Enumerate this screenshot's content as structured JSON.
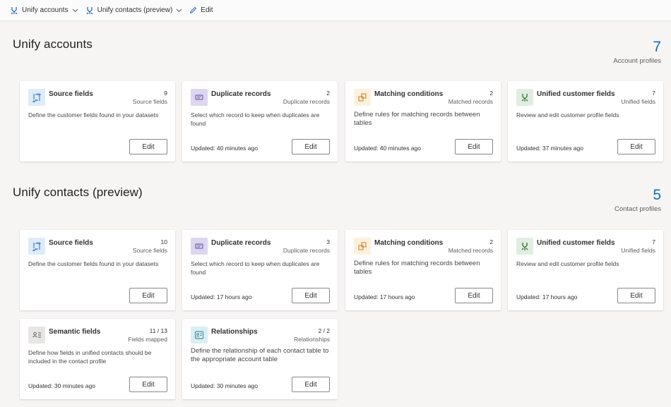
{
  "commandbar": {
    "items": [
      {
        "label": "Unify accounts",
        "has_dropdown": true,
        "icon": "unify-icon"
      },
      {
        "label": "Unify contacts (preview)",
        "has_dropdown": true,
        "icon": "unify-icon"
      },
      {
        "label": "Edit",
        "has_dropdown": false,
        "icon": "pencil-icon"
      }
    ]
  },
  "accounts": {
    "title": "Unify accounts",
    "metric_value": "7",
    "metric_label": "Account profiles",
    "cards": [
      {
        "title": "Source fields",
        "count": "9",
        "unit": "Source fields",
        "desc": "Define the customer fields found in your datasets",
        "updated": "",
        "button": "Edit",
        "icon": "source-fields-icon"
      },
      {
        "title": "Duplicate records",
        "count": "2",
        "unit": "Duplicate records",
        "desc": "Select which record to keep when duplicates are found",
        "updated": "Updated: 40 minutes ago",
        "button": "Edit",
        "icon": "duplicate-records-icon"
      },
      {
        "title": "Matching conditions",
        "count": "2",
        "unit": "Matched records",
        "desc": "Define rules for matching records between tables",
        "updated": "Updated: 40 minutes ago",
        "button": "Edit",
        "icon": "matching-conditions-icon"
      },
      {
        "title": "Unified customer fields",
        "count": "7",
        "unit": "Unified fields",
        "desc": "Review and edit customer profile fields",
        "updated": "Updated: 37 minutes ago",
        "button": "Edit",
        "icon": "unified-fields-icon"
      }
    ]
  },
  "contacts": {
    "title": "Unify contacts (preview)",
    "metric_value": "5",
    "metric_label": "Contact profiles",
    "cards": [
      {
        "title": "Source fields",
        "count": "10",
        "unit": "Source fields",
        "desc": "Define the customer fields found in your datasets",
        "updated": "",
        "button": "Edit",
        "icon": "source-fields-icon"
      },
      {
        "title": "Duplicate records",
        "count": "3",
        "unit": "Duplicate records",
        "desc": "Select which record to keep when duplicates are found",
        "updated": "Updated: 17 hours ago",
        "button": "Edit",
        "icon": "duplicate-records-icon"
      },
      {
        "title": "Matching conditions",
        "count": "2",
        "unit": "Matched records",
        "desc": "Define rules for matching records between tables",
        "updated": "Updated: 17 hours ago",
        "button": "Edit",
        "icon": "matching-conditions-icon"
      },
      {
        "title": "Unified customer fields",
        "count": "7",
        "unit": "Unified fields",
        "desc": "Review and edit customer profile fields",
        "updated": "Updated: 17 hours ago",
        "button": "Edit",
        "icon": "unified-fields-icon"
      },
      {
        "title": "Semantic fields",
        "count": "11 / 13",
        "unit": "Fields mapped",
        "desc": "Define how fields in unified contacts should be included in the contact profile",
        "updated": "Updated: 30 minutes ago",
        "button": "Edit",
        "icon": "semantic-fields-icon"
      },
      {
        "title": "Relationships",
        "count": "2 / 2",
        "unit": "Relationships",
        "desc": "Define the relationship of each contact table to the appropriate account table",
        "updated": "Updated: 30 minutes ago",
        "button": "Edit",
        "icon": "relationships-icon"
      }
    ]
  }
}
